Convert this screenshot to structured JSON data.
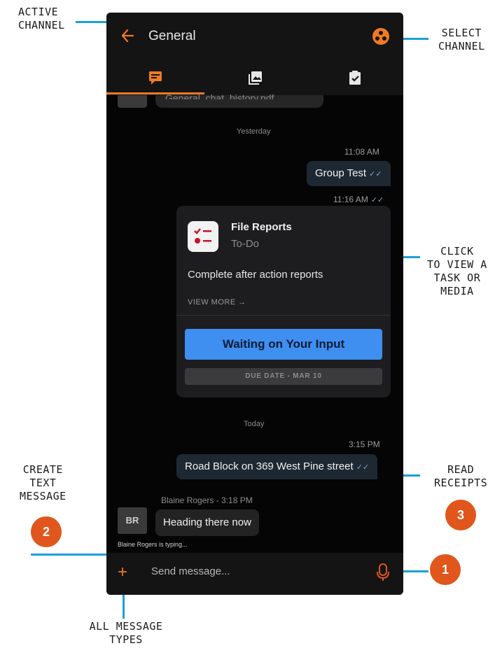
{
  "annotations": {
    "active_channel": "ACTIVE CHANNEL",
    "active_channel_l1": "ACTIVE",
    "active_channel_l2": "CHANNEL",
    "select_channel_l1": "SELECT",
    "select_channel_l2": "CHANNEL",
    "click_view_l1": "CLICK",
    "click_view_l2": "TO VIEW A",
    "click_view_l3": "TASK OR",
    "click_view_l4": "MEDIA",
    "create_text_l1": "CREATE",
    "create_text_l2": "TEXT",
    "create_text_l3": "MESSAGE",
    "read_receipts_l1": "READ",
    "read_receipts_l2": "RECEIPTS",
    "all_types_l1": "ALL MESSAGE",
    "all_types_l2": "TYPES",
    "badge_1": "1",
    "badge_2": "2",
    "badge_3": "3"
  },
  "header": {
    "title": "General"
  },
  "peek": {
    "text": "General_chat_history.pdf"
  },
  "messages": {
    "sep_yesterday": "Yesterday",
    "time_1108": "11:08 AM",
    "group_test": "Group Test",
    "time_1116": "11:16 AM",
    "sep_today": "Today",
    "time_315": "3:15 PM",
    "road_block": "Road Block on 369 West Pine street",
    "sender": "Blaine Rogers - 3:18 PM",
    "avatar": "BR",
    "heading": "Heading there now",
    "typing": "Blaine Rogers is typing..."
  },
  "task": {
    "title": "File Reports",
    "subtitle": "To-Do",
    "description": "Complete after action reports",
    "view_more": "VIEW MORE →",
    "button": "Waiting on Your Input",
    "due": "DUE DATE - MAR 10"
  },
  "composer": {
    "placeholder": "Send message...",
    "plus": "+"
  },
  "colors": {
    "accent": "#f07a24",
    "annotation_line": "#1aa0d8",
    "badge": "#e0561c",
    "button": "#3f8ff0"
  }
}
